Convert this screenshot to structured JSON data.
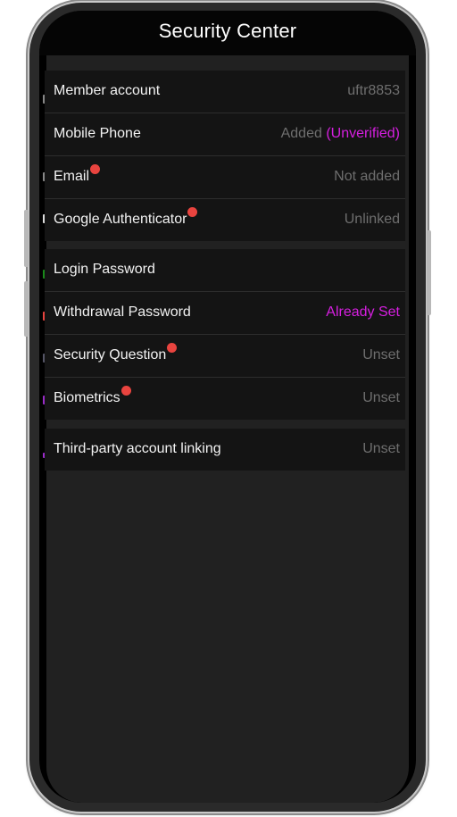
{
  "header": {
    "title": "Security Center"
  },
  "colors": {
    "accent": "#d61fe0",
    "badge": "#e9443f",
    "muted": "#6e6e6e"
  },
  "groups": [
    {
      "rows": [
        {
          "label": "Member account",
          "value": "uftr8853",
          "badge": false
        },
        {
          "label": "Mobile Phone",
          "value": "Added",
          "value_accent": "(Unverified)",
          "badge": false
        },
        {
          "label": "Email",
          "value": "Not added",
          "badge": true
        },
        {
          "label": "Google Authenticator",
          "value": "Unlinked",
          "badge": true
        }
      ]
    },
    {
      "rows": [
        {
          "label": "Login Password",
          "value": "",
          "badge": false
        },
        {
          "label": "Withdrawal Password",
          "value": "Already Set",
          "accent": true,
          "badge": false
        },
        {
          "label": "Security Question",
          "value": "Unset",
          "badge": true
        },
        {
          "label": "Biometrics",
          "value": "Unset",
          "badge": true
        }
      ]
    },
    {
      "rows": [
        {
          "label": "Third-party account linking",
          "value": "Unset",
          "badge": false
        }
      ]
    }
  ]
}
